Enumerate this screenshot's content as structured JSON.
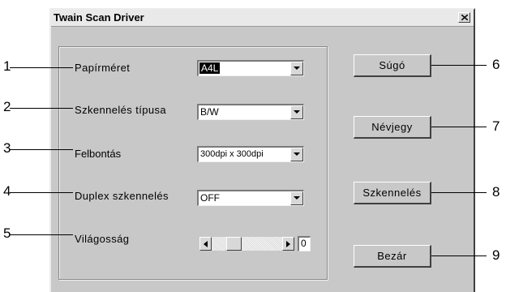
{
  "window": {
    "title": "Twain Scan Driver"
  },
  "icons": {
    "close": "close-icon",
    "dropdown": "chevron-down-icon",
    "slider_left": "arrow-left-icon",
    "slider_right": "arrow-right-icon"
  },
  "fields": [
    {
      "label": "Papírméret",
      "value": "A4L",
      "selected": true
    },
    {
      "label": "Szkennelés típusa",
      "value": "B/W"
    },
    {
      "label": "Felbontás",
      "value": "300dpi x 300dpi"
    },
    {
      "label": "Duplex szkennelés",
      "value": "OFF"
    }
  ],
  "brightness": {
    "label": "Világosság",
    "value": "0"
  },
  "buttons": {
    "help": "Súgó",
    "about": "Névjegy",
    "scan": "Szkennelés",
    "close": "Bezár"
  },
  "callouts": [
    "1",
    "2",
    "3",
    "4",
    "5",
    "6",
    "7",
    "8",
    "9"
  ]
}
